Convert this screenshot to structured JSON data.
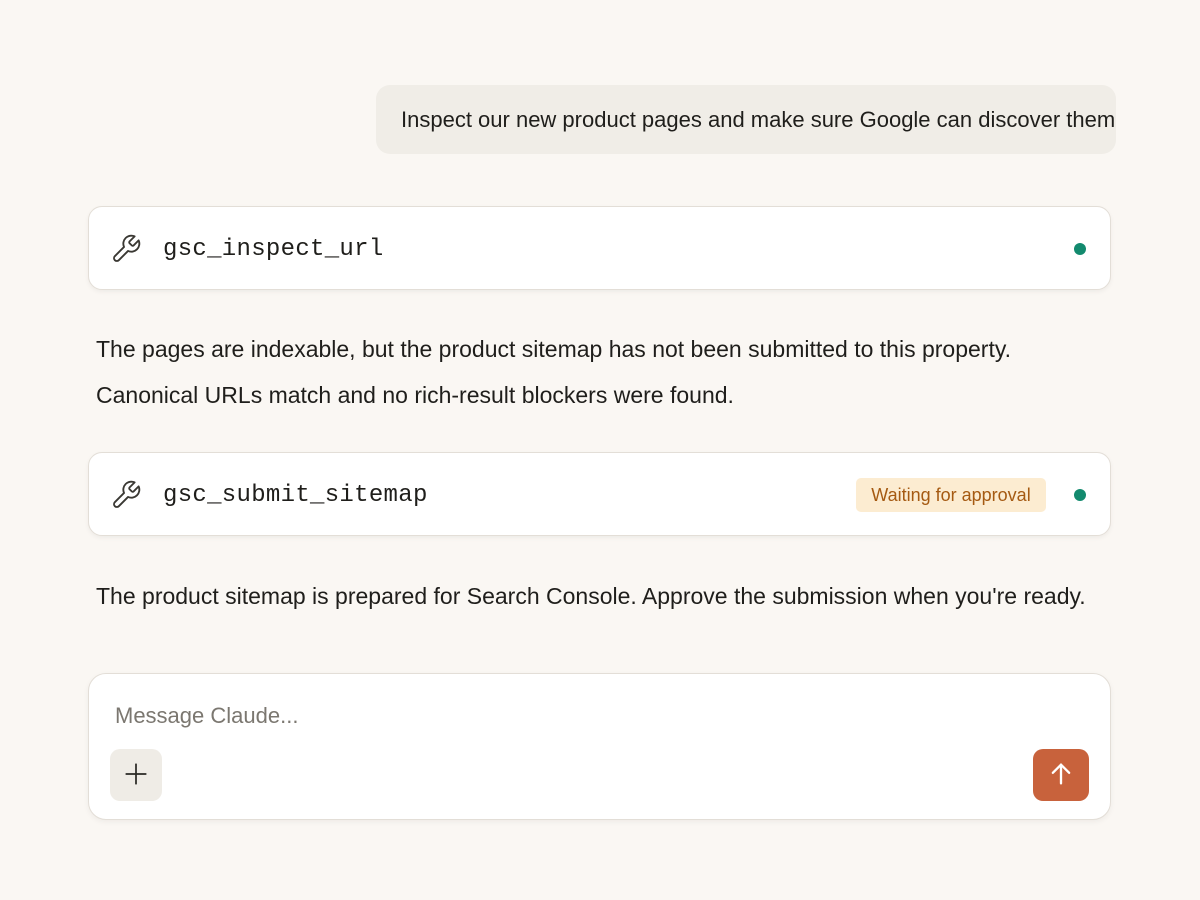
{
  "conversation": {
    "user_message": "Inspect our new product pages and make sure Google can discover them",
    "tool_calls": [
      {
        "name": "gsc_inspect_url",
        "icon": "wrench-icon",
        "status_color": "#138a6e"
      },
      {
        "name": "gsc_submit_sitemap",
        "icon": "wrench-icon",
        "badge": "Waiting for approval",
        "status_color": "#138a6e"
      }
    ],
    "assistant_messages": [
      {
        "lines": [
          "The pages are indexable, but the product sitemap has not been submitted to this property.",
          "Canonical URLs match and no rich-result blockers were found."
        ]
      },
      {
        "lines": [
          "The product sitemap is prepared for Search Console. Approve the submission when you're ready."
        ]
      }
    ]
  },
  "composer": {
    "placeholder": "Message Claude...",
    "value": "",
    "add_icon": "plus-icon",
    "send_icon": "arrow-up-icon"
  },
  "colors": {
    "background": "#faf7f3",
    "user_bubble": "#f0ede7",
    "status_green": "#138a6e",
    "badge_bg": "#fcecd1",
    "badge_text": "#a55a12",
    "send_button": "#c8623c"
  }
}
